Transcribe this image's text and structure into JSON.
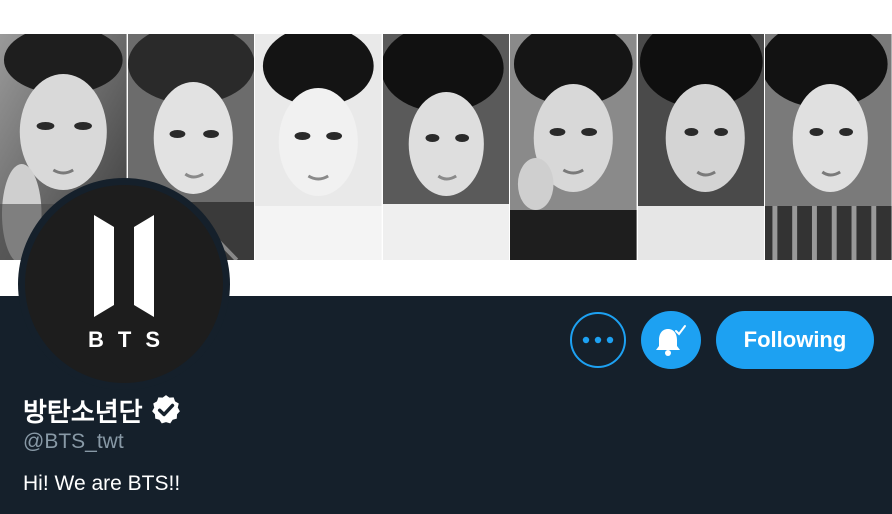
{
  "banner": {
    "panels": [
      "member-1",
      "member-2",
      "member-3",
      "member-4",
      "member-5",
      "member-6",
      "member-7"
    ]
  },
  "avatar": {
    "logo_text": "BTS"
  },
  "actions": {
    "more_icon": "more-dots-icon",
    "notification_icon": "bell-check-icon",
    "following_label": "Following"
  },
  "profile": {
    "display_name": "방탄소년단",
    "verified_icon": "verified-badge-icon",
    "handle": "@BTS_twt",
    "bio": "Hi! We are BTS!!"
  },
  "colors": {
    "background": "#15202b",
    "accent": "#1da1f2",
    "secondary_text": "#8899a6"
  }
}
